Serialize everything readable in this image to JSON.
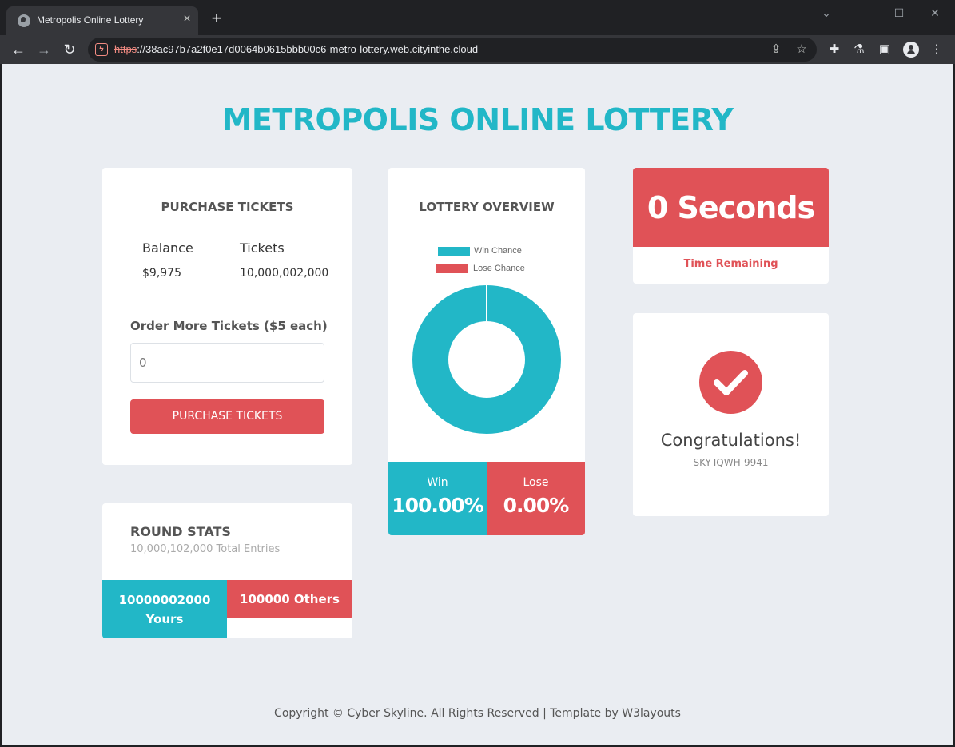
{
  "browser": {
    "tab_title": "Metropolis Online Lottery",
    "url_scheme": "https",
    "url_rest": "://38ac97b7a2f0e17d0064b0615bbb00c6-metro-lottery.web.cityinthe.cloud"
  },
  "site": {
    "title": "METROPOLIS ONLINE LOTTERY"
  },
  "purchase": {
    "heading": "PURCHASE TICKETS",
    "balance_label": "Balance",
    "balance_value": "$9,975",
    "tickets_label": "Tickets",
    "tickets_value": "10,000,002,000",
    "order_label": "Order More Tickets ($5 each)",
    "quantity_placeholder": "0",
    "button_label": "PURCHASE TICKETS"
  },
  "round_stats": {
    "title": "ROUND STATS",
    "subtitle": "10,000,102,000 Total Entries",
    "yours_count": "10000002000",
    "yours_label": "Yours",
    "others_label": "100000 Others"
  },
  "overview": {
    "heading": "LOTTERY OVERVIEW",
    "legend": [
      {
        "label": "Win Chance",
        "color": "#22b7c7"
      },
      {
        "label": "Lose Chance",
        "color": "#e05257"
      }
    ],
    "win_label": "Win",
    "win_value": "100.00%",
    "lose_label": "Lose",
    "lose_value": "0.00%"
  },
  "chart_data": {
    "type": "pie",
    "categories": [
      "Win Chance",
      "Lose Chance"
    ],
    "values": [
      100,
      0
    ],
    "colors": [
      "#22b7c7",
      "#e05257"
    ]
  },
  "timer": {
    "value": "0 Seconds",
    "label": "Time Remaining"
  },
  "result": {
    "title": "Congratulations!",
    "code": "SKY-IQWH-9941"
  },
  "footer": {
    "text": "Copyright © Cyber Skyline. All Rights Reserved | Template by W3layouts"
  },
  "colors": {
    "accent_teal": "#22b7c7",
    "accent_red": "#e05257",
    "page_bg": "#eaedf2"
  }
}
